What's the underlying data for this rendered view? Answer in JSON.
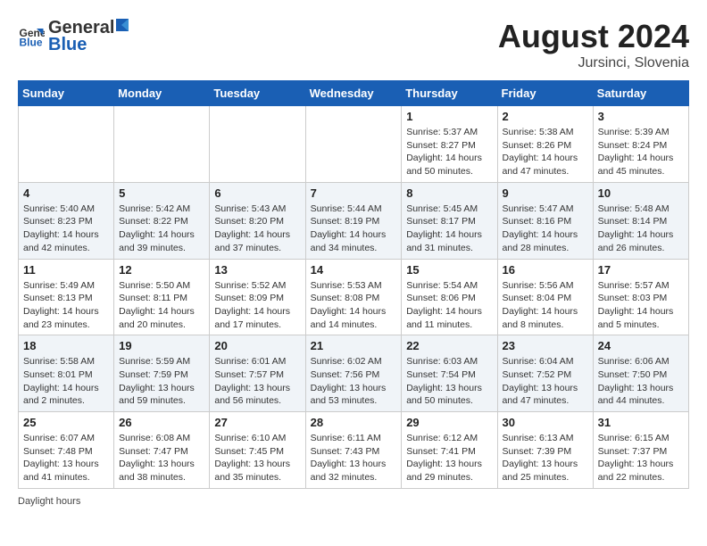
{
  "header": {
    "logo_general": "General",
    "logo_blue": "Blue",
    "month_year": "August 2024",
    "location": "Jursinci, Slovenia"
  },
  "days_of_week": [
    "Sunday",
    "Monday",
    "Tuesday",
    "Wednesday",
    "Thursday",
    "Friday",
    "Saturday"
  ],
  "weeks": [
    [
      {
        "day": "",
        "sunrise": "",
        "sunset": "",
        "daylight": ""
      },
      {
        "day": "",
        "sunrise": "",
        "sunset": "",
        "daylight": ""
      },
      {
        "day": "",
        "sunrise": "",
        "sunset": "",
        "daylight": ""
      },
      {
        "day": "",
        "sunrise": "",
        "sunset": "",
        "daylight": ""
      },
      {
        "day": "1",
        "sunrise": "Sunrise: 5:37 AM",
        "sunset": "Sunset: 8:27 PM",
        "daylight": "Daylight: 14 hours and 50 minutes."
      },
      {
        "day": "2",
        "sunrise": "Sunrise: 5:38 AM",
        "sunset": "Sunset: 8:26 PM",
        "daylight": "Daylight: 14 hours and 47 minutes."
      },
      {
        "day": "3",
        "sunrise": "Sunrise: 5:39 AM",
        "sunset": "Sunset: 8:24 PM",
        "daylight": "Daylight: 14 hours and 45 minutes."
      }
    ],
    [
      {
        "day": "4",
        "sunrise": "Sunrise: 5:40 AM",
        "sunset": "Sunset: 8:23 PM",
        "daylight": "Daylight: 14 hours and 42 minutes."
      },
      {
        "day": "5",
        "sunrise": "Sunrise: 5:42 AM",
        "sunset": "Sunset: 8:22 PM",
        "daylight": "Daylight: 14 hours and 39 minutes."
      },
      {
        "day": "6",
        "sunrise": "Sunrise: 5:43 AM",
        "sunset": "Sunset: 8:20 PM",
        "daylight": "Daylight: 14 hours and 37 minutes."
      },
      {
        "day": "7",
        "sunrise": "Sunrise: 5:44 AM",
        "sunset": "Sunset: 8:19 PM",
        "daylight": "Daylight: 14 hours and 34 minutes."
      },
      {
        "day": "8",
        "sunrise": "Sunrise: 5:45 AM",
        "sunset": "Sunset: 8:17 PM",
        "daylight": "Daylight: 14 hours and 31 minutes."
      },
      {
        "day": "9",
        "sunrise": "Sunrise: 5:47 AM",
        "sunset": "Sunset: 8:16 PM",
        "daylight": "Daylight: 14 hours and 28 minutes."
      },
      {
        "day": "10",
        "sunrise": "Sunrise: 5:48 AM",
        "sunset": "Sunset: 8:14 PM",
        "daylight": "Daylight: 14 hours and 26 minutes."
      }
    ],
    [
      {
        "day": "11",
        "sunrise": "Sunrise: 5:49 AM",
        "sunset": "Sunset: 8:13 PM",
        "daylight": "Daylight: 14 hours and 23 minutes."
      },
      {
        "day": "12",
        "sunrise": "Sunrise: 5:50 AM",
        "sunset": "Sunset: 8:11 PM",
        "daylight": "Daylight: 14 hours and 20 minutes."
      },
      {
        "day": "13",
        "sunrise": "Sunrise: 5:52 AM",
        "sunset": "Sunset: 8:09 PM",
        "daylight": "Daylight: 14 hours and 17 minutes."
      },
      {
        "day": "14",
        "sunrise": "Sunrise: 5:53 AM",
        "sunset": "Sunset: 8:08 PM",
        "daylight": "Daylight: 14 hours and 14 minutes."
      },
      {
        "day": "15",
        "sunrise": "Sunrise: 5:54 AM",
        "sunset": "Sunset: 8:06 PM",
        "daylight": "Daylight: 14 hours and 11 minutes."
      },
      {
        "day": "16",
        "sunrise": "Sunrise: 5:56 AM",
        "sunset": "Sunset: 8:04 PM",
        "daylight": "Daylight: 14 hours and 8 minutes."
      },
      {
        "day": "17",
        "sunrise": "Sunrise: 5:57 AM",
        "sunset": "Sunset: 8:03 PM",
        "daylight": "Daylight: 14 hours and 5 minutes."
      }
    ],
    [
      {
        "day": "18",
        "sunrise": "Sunrise: 5:58 AM",
        "sunset": "Sunset: 8:01 PM",
        "daylight": "Daylight: 14 hours and 2 minutes."
      },
      {
        "day": "19",
        "sunrise": "Sunrise: 5:59 AM",
        "sunset": "Sunset: 7:59 PM",
        "daylight": "Daylight: 13 hours and 59 minutes."
      },
      {
        "day": "20",
        "sunrise": "Sunrise: 6:01 AM",
        "sunset": "Sunset: 7:57 PM",
        "daylight": "Daylight: 13 hours and 56 minutes."
      },
      {
        "day": "21",
        "sunrise": "Sunrise: 6:02 AM",
        "sunset": "Sunset: 7:56 PM",
        "daylight": "Daylight: 13 hours and 53 minutes."
      },
      {
        "day": "22",
        "sunrise": "Sunrise: 6:03 AM",
        "sunset": "Sunset: 7:54 PM",
        "daylight": "Daylight: 13 hours and 50 minutes."
      },
      {
        "day": "23",
        "sunrise": "Sunrise: 6:04 AM",
        "sunset": "Sunset: 7:52 PM",
        "daylight": "Daylight: 13 hours and 47 minutes."
      },
      {
        "day": "24",
        "sunrise": "Sunrise: 6:06 AM",
        "sunset": "Sunset: 7:50 PM",
        "daylight": "Daylight: 13 hours and 44 minutes."
      }
    ],
    [
      {
        "day": "25",
        "sunrise": "Sunrise: 6:07 AM",
        "sunset": "Sunset: 7:48 PM",
        "daylight": "Daylight: 13 hours and 41 minutes."
      },
      {
        "day": "26",
        "sunrise": "Sunrise: 6:08 AM",
        "sunset": "Sunset: 7:47 PM",
        "daylight": "Daylight: 13 hours and 38 minutes."
      },
      {
        "day": "27",
        "sunrise": "Sunrise: 6:10 AM",
        "sunset": "Sunset: 7:45 PM",
        "daylight": "Daylight: 13 hours and 35 minutes."
      },
      {
        "day": "28",
        "sunrise": "Sunrise: 6:11 AM",
        "sunset": "Sunset: 7:43 PM",
        "daylight": "Daylight: 13 hours and 32 minutes."
      },
      {
        "day": "29",
        "sunrise": "Sunrise: 6:12 AM",
        "sunset": "Sunset: 7:41 PM",
        "daylight": "Daylight: 13 hours and 29 minutes."
      },
      {
        "day": "30",
        "sunrise": "Sunrise: 6:13 AM",
        "sunset": "Sunset: 7:39 PM",
        "daylight": "Daylight: 13 hours and 25 minutes."
      },
      {
        "day": "31",
        "sunrise": "Sunrise: 6:15 AM",
        "sunset": "Sunset: 7:37 PM",
        "daylight": "Daylight: 13 hours and 22 minutes."
      }
    ]
  ],
  "footer": {
    "note": "Daylight hours"
  }
}
